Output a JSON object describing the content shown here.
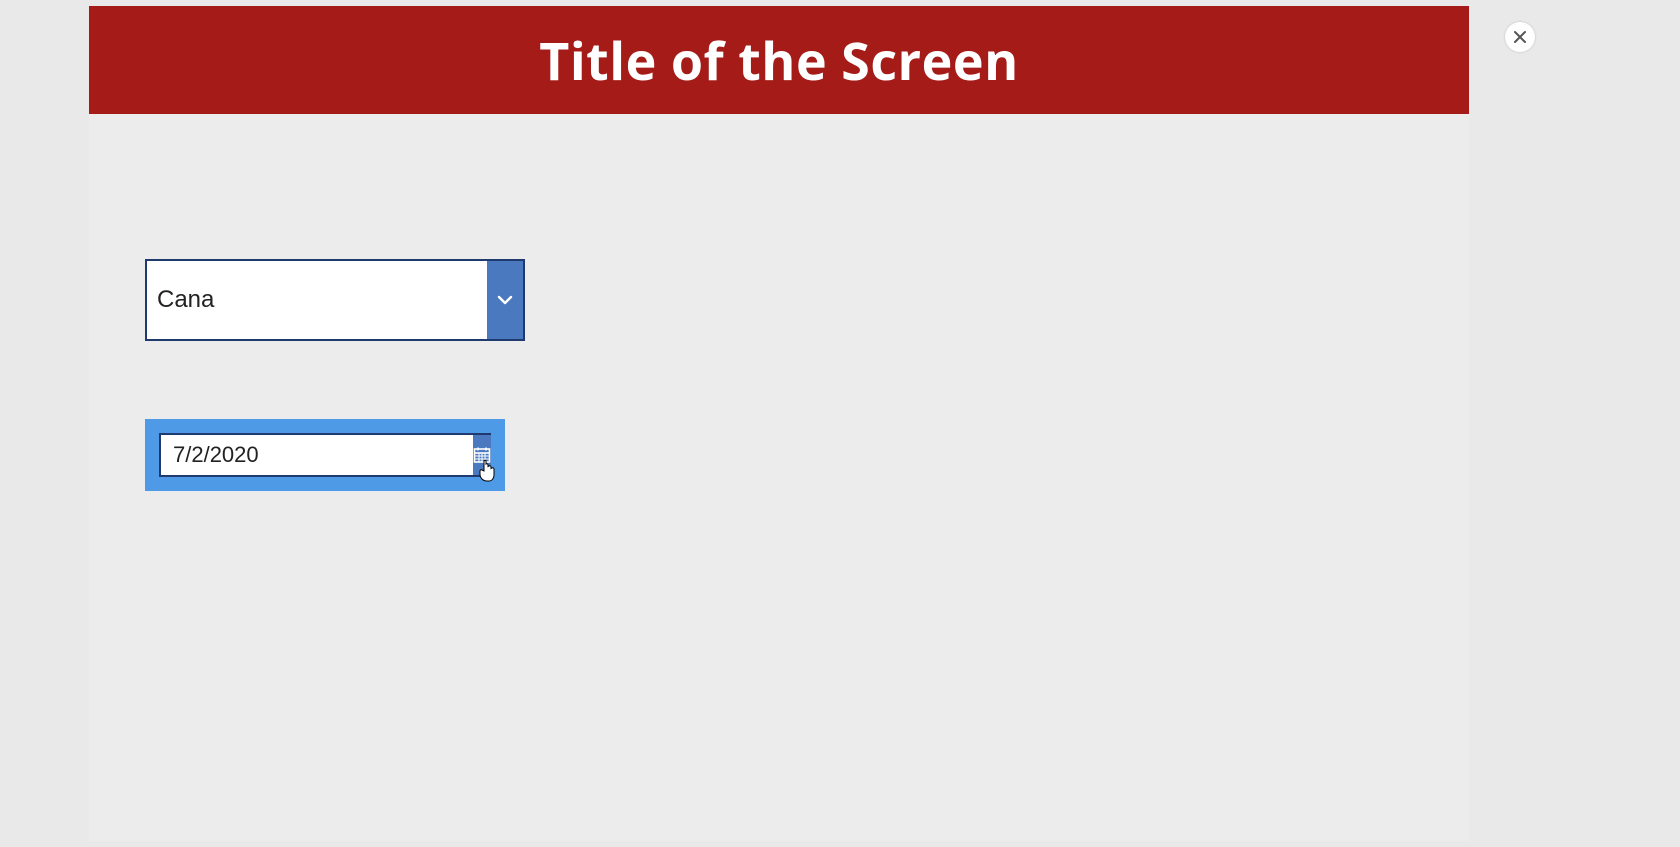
{
  "header": {
    "title": "Title of the Screen"
  },
  "combo": {
    "value": "Cana"
  },
  "datepicker": {
    "value": "7/2/2020"
  },
  "colors": {
    "header_bg": "#a41b18",
    "accent_blue": "#4a79bf",
    "selection_blue": "#4e9ae6",
    "border_navy": "#1e3a6e",
    "page_bg": "#e9e9e9"
  },
  "icons": {
    "dropdown": "chevron-down-icon",
    "calendar": "calendar-icon",
    "close": "close-icon",
    "cursor": "pointer-cursor-icon"
  }
}
